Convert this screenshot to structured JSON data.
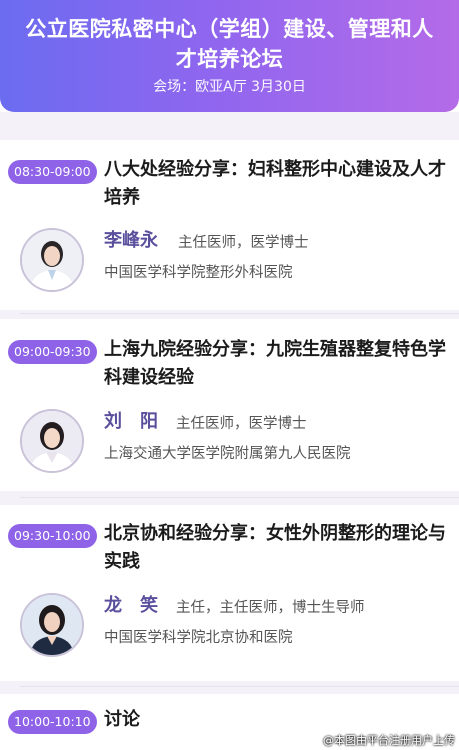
{
  "header": {
    "title": "公立医院私密中心（学组）建设、管理和人才培养论坛",
    "venue": "会场：欧亚A厅   3月30日"
  },
  "sessions": [
    {
      "time": "08:30-09:00",
      "title": "八大处经验分享：妇科整形中心建设及人才培养",
      "speaker": {
        "name": "李峰永",
        "title": "主任医师，医学博士",
        "org": "中国医学科学院整形外科医院"
      }
    },
    {
      "time": "09:00-09:30",
      "title": "上海九院经验分享：九院生殖器整复特色学科建设经验",
      "speaker": {
        "name": "刘　阳",
        "title": "主任医师，医学博士",
        "org": "上海交通大学医学院附属第九人民医院"
      }
    },
    {
      "time": "09:30-10:00",
      "title": "北京协和经验分享：女性外阴整形的理论与实践",
      "speaker": {
        "name": "龙　笑",
        "title": "主任，主任医师，博士生导师",
        "org": "中国医学科学院北京协和医院"
      }
    },
    {
      "time": "10:00-10:10",
      "title": "讨论"
    }
  ],
  "watermark": "@本图由平台注册用户上传",
  "colors": {
    "header_gradient_start": "#6b6cf0",
    "header_gradient_end": "#b46be8",
    "time_pill": "#8e63e8",
    "speaker_name": "#5a4f9c",
    "page_bg": "#f4f2f8"
  }
}
